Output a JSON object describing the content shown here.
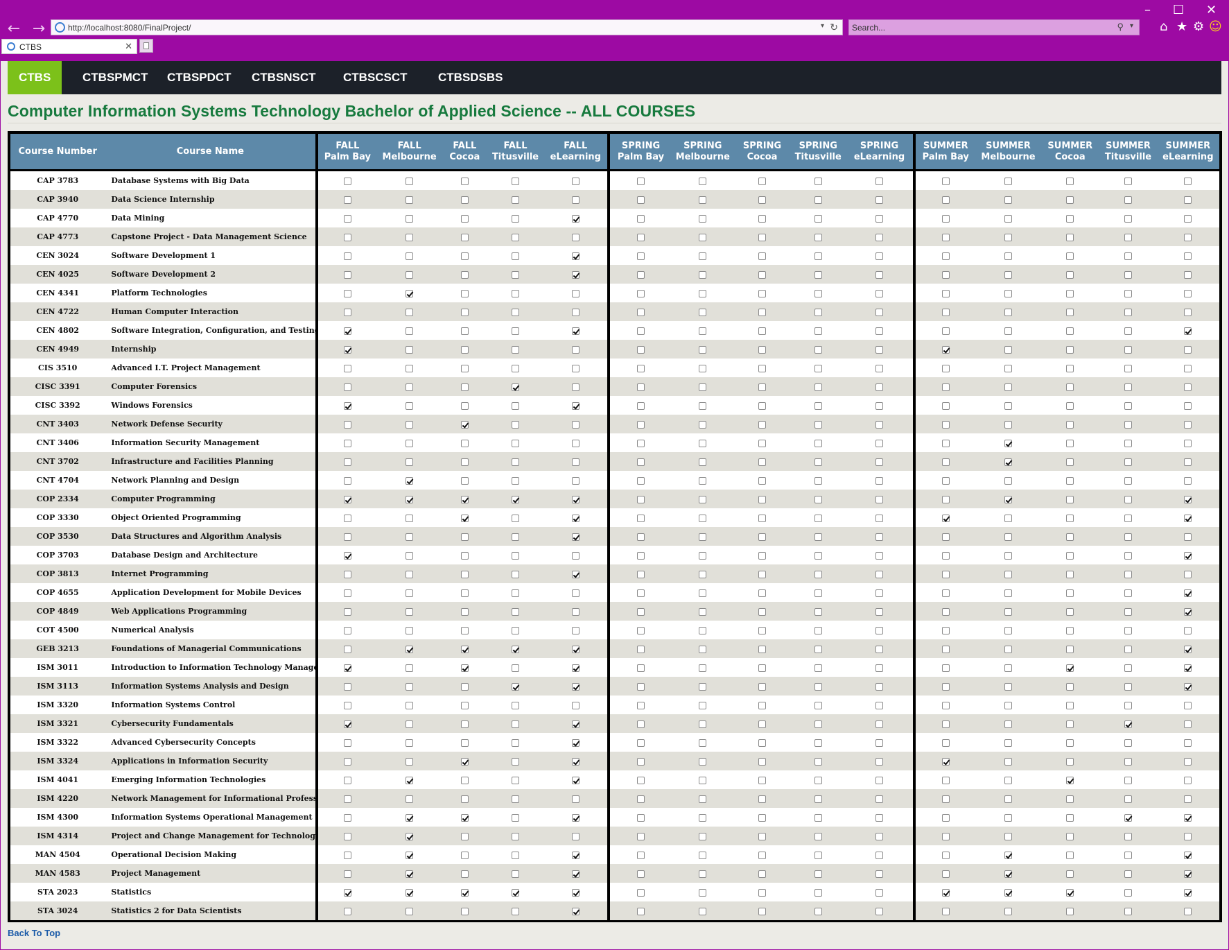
{
  "browser": {
    "url": "http://localhost:8080/FinalProject/",
    "search_placeholder": "Search...",
    "tab_title": "CTBS"
  },
  "nav": {
    "items": [
      {
        "label": "CTBS",
        "active": true
      },
      {
        "label": "CTBSPMCT",
        "active": false
      },
      {
        "label": "CTBSPDCT",
        "active": false
      },
      {
        "label": "CTBSNSCT",
        "active": false
      },
      {
        "label": "CTBSCSCT",
        "active": false
      },
      {
        "label": "CTBSDSBS",
        "active": false
      }
    ]
  },
  "page_title": "Computer Information Systems Technology Bachelor of Applied Science -- ALL COURSES",
  "table": {
    "headers": {
      "course_number": "Course Number",
      "course_name": "Course Name",
      "terms": [
        {
          "term": "FALL",
          "campus": "Palm Bay"
        },
        {
          "term": "FALL",
          "campus": "Melbourne"
        },
        {
          "term": "FALL",
          "campus": "Cocoa"
        },
        {
          "term": "FALL",
          "campus": "Titusville"
        },
        {
          "term": "FALL",
          "campus": "eLearning"
        },
        {
          "term": "SPRING",
          "campus": "Palm Bay"
        },
        {
          "term": "SPRING",
          "campus": "Melbourne"
        },
        {
          "term": "SPRING",
          "campus": "Cocoa"
        },
        {
          "term": "SPRING",
          "campus": "Titusville"
        },
        {
          "term": "SPRING",
          "campus": "eLearning"
        },
        {
          "term": "SUMMER",
          "campus": "Palm Bay"
        },
        {
          "term": "SUMMER",
          "campus": "Melbourne"
        },
        {
          "term": "SUMMER",
          "campus": "Cocoa"
        },
        {
          "term": "SUMMER",
          "campus": "Titusville"
        },
        {
          "term": "SUMMER",
          "campus": "eLearning"
        }
      ]
    },
    "rows": [
      {
        "number": "CAP 3783",
        "name": "Database Systems with Big Data",
        "checks": [
          0,
          0,
          0,
          0,
          0,
          0,
          0,
          0,
          0,
          0,
          0,
          0,
          0,
          0,
          0
        ]
      },
      {
        "number": "CAP 3940",
        "name": "Data Science Internship",
        "checks": [
          0,
          0,
          0,
          0,
          0,
          0,
          0,
          0,
          0,
          0,
          0,
          0,
          0,
          0,
          0
        ]
      },
      {
        "number": "CAP 4770",
        "name": "Data Mining",
        "checks": [
          0,
          0,
          0,
          0,
          1,
          0,
          0,
          0,
          0,
          0,
          0,
          0,
          0,
          0,
          0
        ]
      },
      {
        "number": "CAP 4773",
        "name": "Capstone Project - Data Management Science",
        "checks": [
          0,
          0,
          0,
          0,
          0,
          0,
          0,
          0,
          0,
          0,
          0,
          0,
          0,
          0,
          0
        ]
      },
      {
        "number": "CEN 3024",
        "name": "Software Development 1",
        "checks": [
          0,
          0,
          0,
          0,
          1,
          0,
          0,
          0,
          0,
          0,
          0,
          0,
          0,
          0,
          0
        ]
      },
      {
        "number": "CEN 4025",
        "name": "Software Development 2",
        "checks": [
          0,
          0,
          0,
          0,
          1,
          0,
          0,
          0,
          0,
          0,
          0,
          0,
          0,
          0,
          0
        ]
      },
      {
        "number": "CEN 4341",
        "name": "Platform Technologies",
        "checks": [
          0,
          1,
          0,
          0,
          0,
          0,
          0,
          0,
          0,
          0,
          0,
          0,
          0,
          0,
          0
        ]
      },
      {
        "number": "CEN 4722",
        "name": "Human Computer Interaction",
        "checks": [
          0,
          0,
          0,
          0,
          0,
          0,
          0,
          0,
          0,
          0,
          0,
          0,
          0,
          0,
          0
        ]
      },
      {
        "number": "CEN 4802",
        "name": "Software Integration, Configuration, and Testing",
        "checks": [
          1,
          0,
          0,
          0,
          1,
          0,
          0,
          0,
          0,
          0,
          0,
          0,
          0,
          0,
          1
        ]
      },
      {
        "number": "CEN 4949",
        "name": "Internship",
        "checks": [
          1,
          0,
          0,
          0,
          0,
          0,
          0,
          0,
          0,
          0,
          1,
          0,
          0,
          0,
          0
        ]
      },
      {
        "number": "CIS 3510",
        "name": "Advanced I.T. Project Management",
        "checks": [
          0,
          0,
          0,
          0,
          0,
          0,
          0,
          0,
          0,
          0,
          0,
          0,
          0,
          0,
          0
        ]
      },
      {
        "number": "CISC 3391",
        "name": "Computer Forensics",
        "checks": [
          0,
          0,
          0,
          1,
          0,
          0,
          0,
          0,
          0,
          0,
          0,
          0,
          0,
          0,
          0
        ]
      },
      {
        "number": "CISC 3392",
        "name": "Windows Forensics",
        "checks": [
          1,
          0,
          0,
          0,
          1,
          0,
          0,
          0,
          0,
          0,
          0,
          0,
          0,
          0,
          0
        ]
      },
      {
        "number": "CNT 3403",
        "name": "Network Defense Security",
        "checks": [
          0,
          0,
          1,
          0,
          0,
          0,
          0,
          0,
          0,
          0,
          0,
          0,
          0,
          0,
          0
        ]
      },
      {
        "number": "CNT 3406",
        "name": "Information Security Management",
        "checks": [
          0,
          0,
          0,
          0,
          0,
          0,
          0,
          0,
          0,
          0,
          0,
          1,
          0,
          0,
          0
        ]
      },
      {
        "number": "CNT 3702",
        "name": "Infrastructure and Facilities Planning",
        "checks": [
          0,
          0,
          0,
          0,
          0,
          0,
          0,
          0,
          0,
          0,
          0,
          1,
          0,
          0,
          0
        ]
      },
      {
        "number": "CNT 4704",
        "name": "Network Planning and Design",
        "checks": [
          0,
          1,
          0,
          0,
          0,
          0,
          0,
          0,
          0,
          0,
          0,
          0,
          0,
          0,
          0
        ]
      },
      {
        "number": "COP 2334",
        "name": "Computer Programming",
        "checks": [
          1,
          1,
          1,
          1,
          1,
          0,
          0,
          0,
          0,
          0,
          0,
          1,
          0,
          0,
          1
        ]
      },
      {
        "number": "COP 3330",
        "name": "Object Oriented Programming",
        "checks": [
          0,
          0,
          1,
          0,
          1,
          0,
          0,
          0,
          0,
          0,
          1,
          0,
          0,
          0,
          1
        ]
      },
      {
        "number": "COP 3530",
        "name": "Data Structures and Algorithm Analysis",
        "checks": [
          0,
          0,
          0,
          0,
          1,
          0,
          0,
          0,
          0,
          0,
          0,
          0,
          0,
          0,
          0
        ]
      },
      {
        "number": "COP 3703",
        "name": "Database Design and Architecture",
        "checks": [
          1,
          0,
          0,
          0,
          0,
          0,
          0,
          0,
          0,
          0,
          0,
          0,
          0,
          0,
          1
        ]
      },
      {
        "number": "COP 3813",
        "name": "Internet Programming",
        "checks": [
          0,
          0,
          0,
          0,
          1,
          0,
          0,
          0,
          0,
          0,
          0,
          0,
          0,
          0,
          0
        ]
      },
      {
        "number": "COP 4655",
        "name": "Application Development for Mobile Devices",
        "checks": [
          0,
          0,
          0,
          0,
          0,
          0,
          0,
          0,
          0,
          0,
          0,
          0,
          0,
          0,
          1
        ]
      },
      {
        "number": "COP 4849",
        "name": "Web Applications Programming",
        "checks": [
          0,
          0,
          0,
          0,
          0,
          0,
          0,
          0,
          0,
          0,
          0,
          0,
          0,
          0,
          1
        ]
      },
      {
        "number": "COT 4500",
        "name": "Numerical Analysis",
        "checks": [
          0,
          0,
          0,
          0,
          0,
          0,
          0,
          0,
          0,
          0,
          0,
          0,
          0,
          0,
          0
        ]
      },
      {
        "number": "GEB 3213",
        "name": "Foundations of Managerial Communications",
        "checks": [
          0,
          1,
          1,
          1,
          1,
          0,
          0,
          0,
          0,
          0,
          0,
          0,
          0,
          0,
          1
        ]
      },
      {
        "number": "ISM 3011",
        "name": "Introduction to Information Technology Management",
        "checks": [
          1,
          0,
          1,
          0,
          1,
          0,
          0,
          0,
          0,
          0,
          0,
          0,
          1,
          0,
          1
        ]
      },
      {
        "number": "ISM 3113",
        "name": "Information Systems Analysis and Design",
        "checks": [
          0,
          0,
          0,
          1,
          1,
          0,
          0,
          0,
          0,
          0,
          0,
          0,
          0,
          0,
          1
        ]
      },
      {
        "number": "ISM 3320",
        "name": "Information Systems Control",
        "checks": [
          0,
          0,
          0,
          0,
          0,
          0,
          0,
          0,
          0,
          0,
          0,
          0,
          0,
          0,
          0
        ]
      },
      {
        "number": "ISM 3321",
        "name": "Cybersecurity Fundamentals",
        "checks": [
          1,
          0,
          0,
          0,
          1,
          0,
          0,
          0,
          0,
          0,
          0,
          0,
          0,
          1,
          0
        ]
      },
      {
        "number": "ISM 3322",
        "name": "Advanced Cybersecurity Concepts",
        "checks": [
          0,
          0,
          0,
          0,
          1,
          0,
          0,
          0,
          0,
          0,
          0,
          0,
          0,
          0,
          0
        ]
      },
      {
        "number": "ISM 3324",
        "name": "Applications in Information Security",
        "checks": [
          0,
          0,
          1,
          0,
          1,
          0,
          0,
          0,
          0,
          0,
          1,
          0,
          0,
          0,
          0
        ]
      },
      {
        "number": "ISM 4041",
        "name": "Emerging Information Technologies",
        "checks": [
          0,
          1,
          0,
          0,
          1,
          0,
          0,
          0,
          0,
          0,
          0,
          0,
          1,
          0,
          0
        ]
      },
      {
        "number": "ISM 4220",
        "name": "Network Management for Informational Professionals",
        "checks": [
          0,
          0,
          0,
          0,
          0,
          0,
          0,
          0,
          0,
          0,
          0,
          0,
          0,
          0,
          0
        ]
      },
      {
        "number": "ISM 4300",
        "name": "Information Systems Operational Management",
        "checks": [
          0,
          1,
          1,
          0,
          1,
          0,
          0,
          0,
          0,
          0,
          0,
          0,
          0,
          1,
          1
        ]
      },
      {
        "number": "ISM 4314",
        "name": "Project and Change Management for Technology",
        "checks": [
          0,
          1,
          0,
          0,
          0,
          0,
          0,
          0,
          0,
          0,
          0,
          0,
          0,
          0,
          0
        ]
      },
      {
        "number": "MAN 4504",
        "name": "Operational Decision Making",
        "checks": [
          0,
          1,
          0,
          0,
          1,
          0,
          0,
          0,
          0,
          0,
          0,
          1,
          0,
          0,
          1
        ]
      },
      {
        "number": "MAN 4583",
        "name": "Project Management",
        "checks": [
          0,
          1,
          0,
          0,
          1,
          0,
          0,
          0,
          0,
          0,
          0,
          1,
          0,
          0,
          1
        ]
      },
      {
        "number": "STA 2023",
        "name": "Statistics",
        "checks": [
          1,
          1,
          1,
          1,
          1,
          0,
          0,
          0,
          0,
          0,
          1,
          1,
          1,
          0,
          1
        ]
      },
      {
        "number": "STA 3024",
        "name": "Statistics 2 for Data Scientists",
        "checks": [
          0,
          0,
          0,
          0,
          1,
          0,
          0,
          0,
          0,
          0,
          0,
          0,
          0,
          0,
          0
        ]
      }
    ]
  },
  "footer": {
    "back_to_top": "Back To Top"
  }
}
